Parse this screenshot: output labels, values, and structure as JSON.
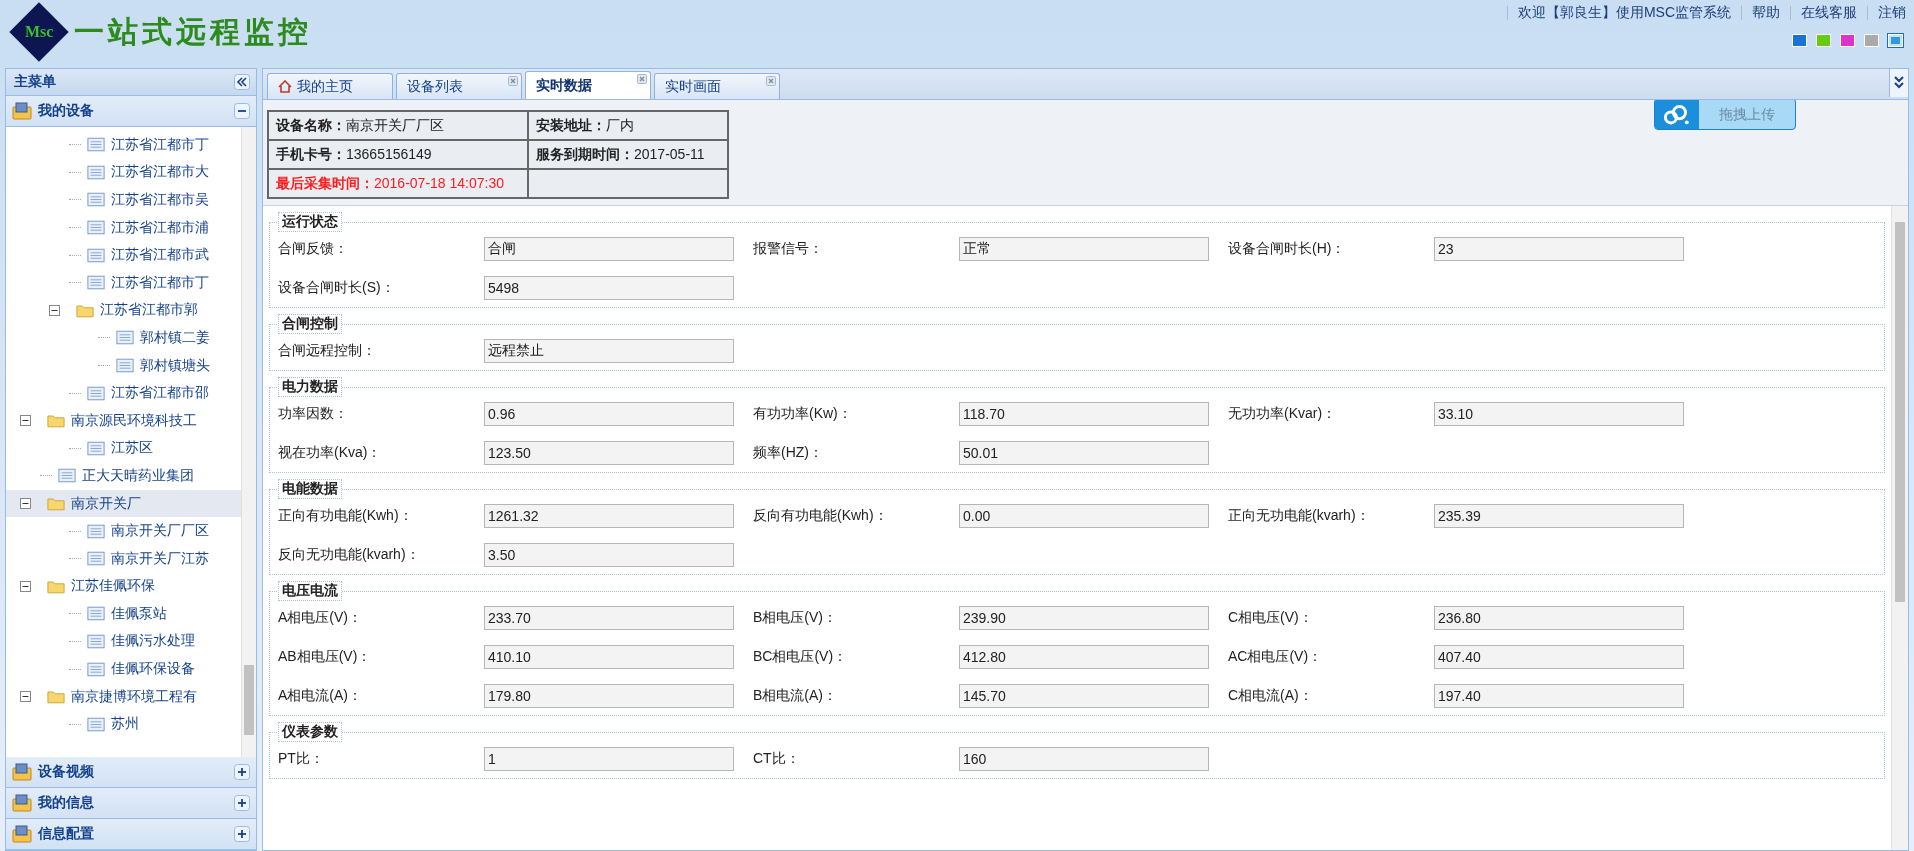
{
  "header": {
    "logo_mark": "Msc",
    "logo_title": "一站式远程监控",
    "links": [
      {
        "label": "欢迎【郭良生】使用MSC监管系统"
      },
      {
        "label": "帮助"
      },
      {
        "label": "在线客服"
      },
      {
        "label": "注销"
      }
    ],
    "themes": [
      {
        "color": "#1a72d8",
        "selected": false
      },
      {
        "color": "#66cc11",
        "selected": false
      },
      {
        "color": "#dd33cc",
        "selected": false
      },
      {
        "color": "#aaaaaa",
        "selected": false
      },
      {
        "color": "#3399dd",
        "selected": true
      }
    ]
  },
  "sidebar": {
    "title": "主菜单",
    "panels": [
      {
        "label": "我的设备",
        "expanded": true
      },
      {
        "label": "设备视频",
        "expanded": false
      },
      {
        "label": "我的信息",
        "expanded": false
      },
      {
        "label": "信息配置",
        "expanded": false
      }
    ],
    "tree": {
      "continued_children": [
        {
          "label": "江苏省江都市丁",
          "kind": "device",
          "selected": false
        },
        {
          "label": "江苏省江都市大",
          "kind": "device",
          "selected": false
        },
        {
          "label": "江苏省江都市吴",
          "kind": "device",
          "selected": false
        },
        {
          "label": "江苏省江都市浦",
          "kind": "device",
          "selected": false
        },
        {
          "label": "江苏省江都市武",
          "kind": "device",
          "selected": false
        },
        {
          "label": "江苏省江都市丁",
          "kind": "device",
          "selected": false
        },
        {
          "label": "江苏省江都市郭",
          "kind": "folder",
          "expanded": true,
          "selected": false,
          "children": [
            {
              "label": "郭村镇二姜",
              "kind": "device",
              "selected": false
            },
            {
              "label": "郭村镇塘头",
              "kind": "device",
              "selected": false
            }
          ]
        },
        {
          "label": "江苏省江都市邵",
          "kind": "device",
          "selected": false
        }
      ],
      "items": [
        {
          "label": "南京源民环境科技工",
          "kind": "folder",
          "expanded": true,
          "selected": false,
          "children": [
            {
              "label": "江苏区",
              "kind": "device",
              "selected": false
            }
          ]
        },
        {
          "label": "正大天晴药业集团",
          "kind": "device",
          "selected": false
        },
        {
          "label": "南京开关厂",
          "kind": "folder",
          "expanded": true,
          "selected": true,
          "children": [
            {
              "label": "南京开关厂厂区",
              "kind": "device",
              "selected": false
            },
            {
              "label": "南京开关厂江苏",
              "kind": "device",
              "selected": false
            }
          ]
        },
        {
          "label": "江苏佳佩环保",
          "kind": "folder",
          "expanded": true,
          "selected": false,
          "children": [
            {
              "label": "佳佩泵站",
              "kind": "device",
              "selected": false
            },
            {
              "label": "佳佩污水处理",
              "kind": "device",
              "selected": false
            },
            {
              "label": "佳佩环保设备",
              "kind": "device",
              "selected": false
            }
          ]
        },
        {
          "label": "南京捷博环境工程有",
          "kind": "folder",
          "expanded": true,
          "selected": false,
          "children": [
            {
              "label": "苏州",
              "kind": "device",
              "selected": false
            }
          ]
        }
      ]
    }
  },
  "tabs": [
    {
      "label": "我的主页",
      "kind": "home",
      "selected": false
    },
    {
      "label": "设备列表",
      "kind": "closable",
      "selected": false
    },
    {
      "label": "实时数据",
      "kind": "closable",
      "selected": true
    },
    {
      "label": "实时画面",
      "kind": "closable",
      "selected": false
    }
  ],
  "upload_button": "拖拽上传",
  "device_info": [
    [
      {
        "label": "设备名称：",
        "value": "南京开关厂厂区",
        "alert": false
      },
      {
        "label": "安装地址：",
        "value": "厂内",
        "alert": false
      }
    ],
    [
      {
        "label": "手机卡号：",
        "value": "13665156149",
        "alert": false
      },
      {
        "label": "服务到期时间：",
        "value": "2017-05-11",
        "alert": false
      }
    ],
    [
      {
        "label": "最后采集时间：",
        "value": "2016-07-18 14:07:30",
        "alert": true
      }
    ]
  ],
  "sections": [
    {
      "title": "运行状态",
      "fields": [
        {
          "label": "合闸反馈：",
          "value": "合闸"
        },
        {
          "label": "报警信号：",
          "value": "正常"
        },
        {
          "label": "设备合闸时长(H)：",
          "value": "23"
        },
        {
          "label": "设备合闸时长(S)：",
          "value": "5498"
        }
      ]
    },
    {
      "title": "合闸控制",
      "fields": [
        {
          "label": "合闸远程控制：",
          "value": "远程禁止"
        }
      ]
    },
    {
      "title": "电力数据",
      "fields": [
        {
          "label": "功率因数：",
          "value": "0.96"
        },
        {
          "label": "有功功率(Kw)：",
          "value": "118.70"
        },
        {
          "label": "无功功率(Kvar)：",
          "value": "33.10"
        },
        {
          "label": "视在功率(Kva)：",
          "value": "123.50"
        },
        {
          "label": "频率(HZ)：",
          "value": "50.01"
        }
      ]
    },
    {
      "title": "电能数据",
      "fields": [
        {
          "label": "正向有功电能(Kwh)：",
          "value": "1261.32"
        },
        {
          "label": "反向有功电能(Kwh)：",
          "value": "0.00"
        },
        {
          "label": "正向无功电能(kvarh)：",
          "value": "235.39"
        },
        {
          "label": "反向无功电能(kvarh)：",
          "value": "3.50"
        }
      ]
    },
    {
      "title": "电压电流",
      "fields": [
        {
          "label": "A相电压(V)：",
          "value": "233.70"
        },
        {
          "label": "B相电压(V)：",
          "value": "239.90"
        },
        {
          "label": "C相电压(V)：",
          "value": "236.80"
        },
        {
          "label": "AB相电压(V)：",
          "value": "410.10"
        },
        {
          "label": "BC相电压(V)：",
          "value": "412.80"
        },
        {
          "label": "AC相电压(V)：",
          "value": "407.40"
        },
        {
          "label": "A相电流(A)：",
          "value": "179.80"
        },
        {
          "label": "B相电流(A)：",
          "value": "145.70"
        },
        {
          "label": "C相电流(A)：",
          "value": "197.40"
        }
      ]
    },
    {
      "title": "仪表参数",
      "fields": [
        {
          "label": "PT比：",
          "value": "1"
        },
        {
          "label": "CT比：",
          "value": "160"
        }
      ]
    }
  ]
}
